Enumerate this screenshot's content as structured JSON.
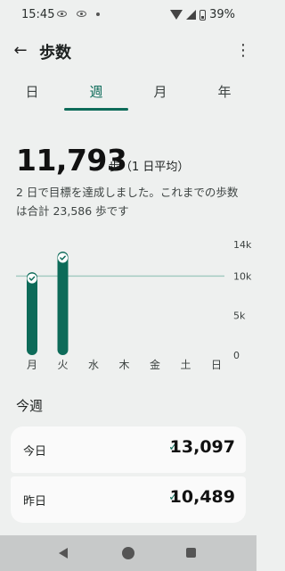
{
  "status_bar": {
    "time": "15:45",
    "battery": "39%"
  },
  "app_bar": {
    "title": "歩数",
    "back_icon": "arrow-left-icon",
    "more_icon": "more-vert-icon"
  },
  "tabs": [
    {
      "label": "日",
      "active": false
    },
    {
      "label": "週",
      "active": true
    },
    {
      "label": "月",
      "active": false
    },
    {
      "label": "年",
      "active": false
    }
  ],
  "summary": {
    "average": "11,793",
    "unit": "歩（1 日平均）",
    "description": "2 日で目標を達成しました。これまでの歩数は合計 23,586 歩です"
  },
  "chart_data": {
    "type": "bar",
    "categories": [
      "月",
      "火",
      "水",
      "木",
      "金",
      "土",
      "日"
    ],
    "values": [
      10489,
      13097,
      null,
      null,
      null,
      null,
      null
    ],
    "goal": 10000,
    "goal_met": [
      true,
      true,
      false,
      false,
      false,
      false,
      false
    ],
    "ylim": [
      0,
      14000
    ],
    "y_ticks": [
      0,
      5000,
      10000,
      14000
    ],
    "y_tick_labels": [
      "0",
      "5k",
      "10k",
      "14k"
    ],
    "bar_color": "#0d6b59",
    "goal_line_color": "#9fc9bf"
  },
  "week": {
    "title": "今週",
    "days": [
      {
        "label": "今日",
        "value": "13,097",
        "check": "✓"
      },
      {
        "label": "昨日",
        "value": "10,489",
        "check": "✓"
      }
    ]
  },
  "colors": {
    "accent": "#0d6b59",
    "background": "#eef0ef"
  }
}
